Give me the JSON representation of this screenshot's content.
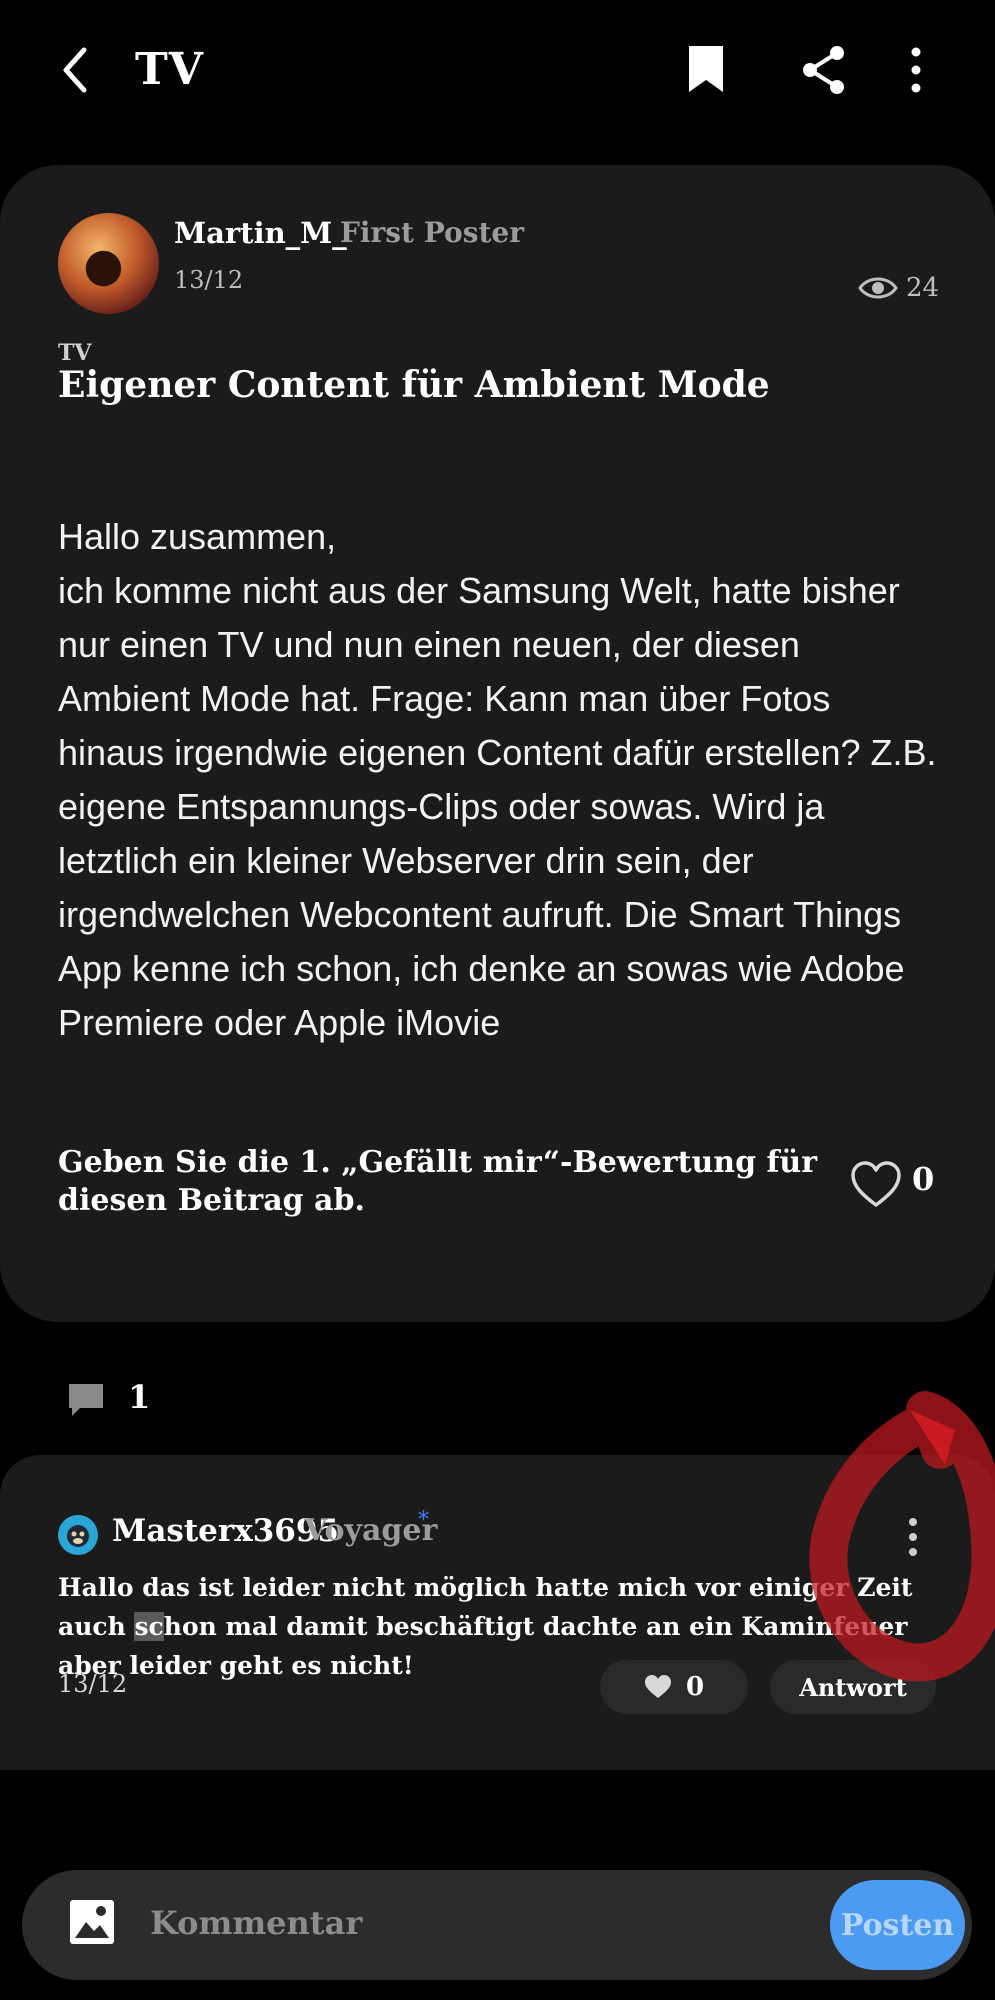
{
  "header": {
    "title": "TV"
  },
  "post": {
    "author": "Martin_M_",
    "rank": "First Poster",
    "date": "13/12",
    "views": "24",
    "category": "TV",
    "title": "Eigener Content für Ambient Mode",
    "body": "Hallo zusammen,\nich komme nicht aus der Samsung Welt, hatte bisher nur einen TV und nun einen neuen, der diesen Ambient Mode hat. Frage: Kann man über Fotos hinaus irgendwie eigenen Content dafür erstellen? Z.B. eigene Entspannungs-Clips oder sowas. Wird ja letztlich ein kleiner Webserver drin sein, der irgendwelchen Webcontent aufruft. Die Smart Things App kenne ich schon, ich denke an sowas wie Adobe Premiere oder Apple iMovie",
    "like_prompt": "Geben Sie die 1. „Gefällt mir“-Bewertung für diesen Beitrag ab.",
    "like_count": "0"
  },
  "comments": {
    "count": "1"
  },
  "reply": {
    "author": "Masterx3695",
    "rank": "Voyager",
    "rank_star": "*",
    "text_before": "Hallo das ist leider nicht möglich hatte mich vor einiger Zeit auch ",
    "text_highlight": "sc",
    "text_after": "hon mal damit beschäftigt dachte an ein Kaminfeuer aber leider geht es nicht!",
    "date": "13/12",
    "like_count": "0",
    "answer_label": "Antwort"
  },
  "composer": {
    "placeholder": "Kommentar",
    "post_label": "Posten"
  },
  "colors": {
    "background": "#000000",
    "card": "#1b1b1b",
    "accent": "#4a9bf1",
    "annotation": "#c0191e"
  }
}
